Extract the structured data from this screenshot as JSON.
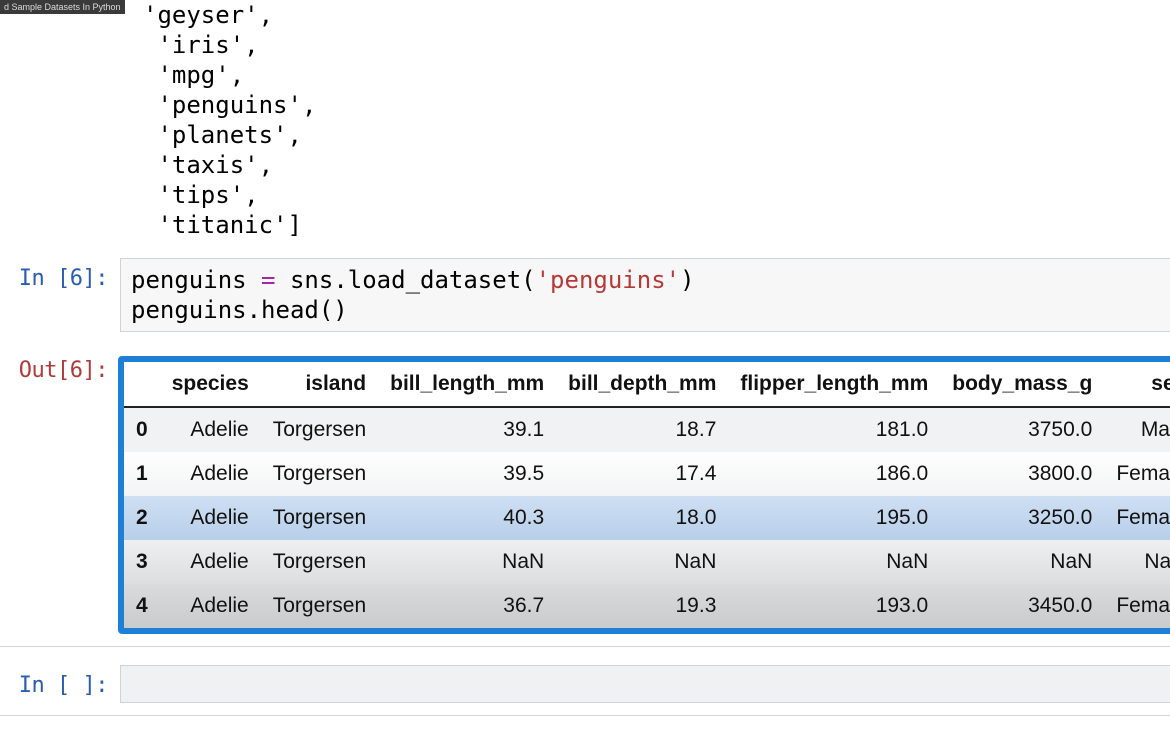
{
  "window": {
    "title": "d Sample Datasets In Python"
  },
  "prev_output": {
    "lines": [
      "'geyser',",
      "'iris',",
      "'mpg',",
      "'penguins',",
      "'planets',",
      "'taxis',",
      "'tips',",
      "'titanic']"
    ]
  },
  "cell6": {
    "prompt_in": "In [6]:",
    "prompt_out": "Out[6]:",
    "code": {
      "var": "penguins",
      "eq": " = ",
      "mod": "sns",
      "dot": ".",
      "fn": "load_dataset",
      "lp": "(",
      "str": "'penguins'",
      "rp": ")",
      "line2a": "penguins",
      "line2b": ".",
      "line2c": "head",
      "line2d": "()"
    }
  },
  "dataframe": {
    "columns": [
      "species",
      "island",
      "bill_length_mm",
      "bill_depth_mm",
      "flipper_length_mm",
      "body_mass_g",
      "sex"
    ],
    "index": [
      "0",
      "1",
      "2",
      "3",
      "4"
    ],
    "rows": [
      [
        "Adelie",
        "Torgersen",
        "39.1",
        "18.7",
        "181.0",
        "3750.0",
        "Male"
      ],
      [
        "Adelie",
        "Torgersen",
        "39.5",
        "17.4",
        "186.0",
        "3800.0",
        "Female"
      ],
      [
        "Adelie",
        "Torgersen",
        "40.3",
        "18.0",
        "195.0",
        "3250.0",
        "Female"
      ],
      [
        "Adelie",
        "Torgersen",
        "NaN",
        "NaN",
        "NaN",
        "NaN",
        "NaN"
      ],
      [
        "Adelie",
        "Torgersen",
        "36.7",
        "19.3",
        "193.0",
        "3450.0",
        "Female"
      ]
    ]
  },
  "empty_cell": {
    "prompt": "In [ ]:"
  }
}
